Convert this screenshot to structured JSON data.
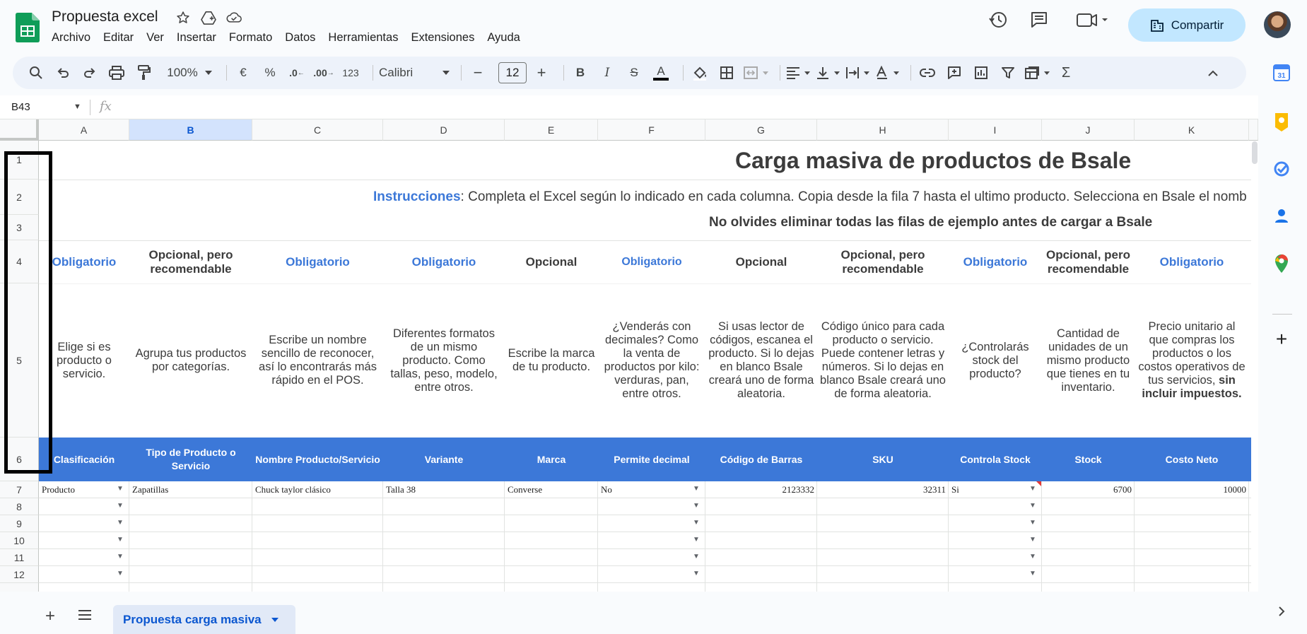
{
  "header": {
    "doc_title": "Propuesta excel",
    "menu": [
      "Archivo",
      "Editar",
      "Ver",
      "Insertar",
      "Formato",
      "Datos",
      "Herramientas",
      "Extensiones",
      "Ayuda"
    ],
    "share_label": "Compartir"
  },
  "toolbar": {
    "zoom": "100%",
    "currency": "€",
    "percent": "%",
    "dec_decrease": ".0",
    "dec_increase": ".00",
    "number_format": "123",
    "font": "Calibri",
    "font_size": "12",
    "bold": "B",
    "italic": "I",
    "strike": "S",
    "text_color": "A",
    "sum": "Σ"
  },
  "formula_bar": {
    "cell_ref": "B43",
    "fx": "fx",
    "value": ""
  },
  "columns": [
    "A",
    "B",
    "C",
    "D",
    "E",
    "F",
    "G",
    "H",
    "I",
    "J",
    "K"
  ],
  "selected_column": "B",
  "rows": [
    "1",
    "2",
    "3",
    "4",
    "5",
    "6",
    "7",
    "8",
    "9",
    "10",
    "11",
    "12"
  ],
  "sheet": {
    "title": "Carga masiva de productos de Bsale",
    "instr_label": "Instrucciones",
    "instr_text": ": Completa el Excel según lo indicado en cada columna. Copia desde la fila 7 hasta el ultimo producto. Selecciona en Bsale el nomb",
    "warning": "No olvides eliminar todas las filas de ejemplo antes de cargar a Bsale",
    "requirement": [
      "Obligatorio",
      "Opcional, pero recomendable",
      "Obligatorio",
      "Obligatorio",
      "Opcional",
      "Obligatorio",
      "Opcional",
      "Opcional, pero recomendable",
      "Obligatorio",
      "Opcional, pero recomendable",
      "Obligatorio"
    ],
    "description": [
      "Elige si es producto o servicio.",
      "Agrupa tus productos por categorías.",
      "Escribe un nombre sencillo de reconocer, así lo encontrarás más rápido en el POS.",
      "Diferentes formatos de un mismo producto. Como tallas, peso, modelo, entre otros.",
      "Escribe la marca de tu producto.",
      "¿Venderás con decimales? Como la venta de productos por kilo: verduras, pan, entre otros.",
      "Si usas lector de códigos, escanea el producto. Si lo dejas en blanco Bsale creará uno de forma aleatoria.",
      "Código único para cada producto o servicio. Puede contener letras y números. Si lo dejas en blanco Bsale creará uno de forma aleatoria.",
      "¿Controlarás stock del producto?",
      "Cantidad de unidades de un mismo producto que tienes en tu inventario.",
      "Precio unitario al que compras los productos o los costos operativos de tus servicios, "
    ],
    "description_k_bold": "sin incluir impuestos.",
    "headers": [
      "Clasificación",
      "Tipo de Producto o Servicio",
      "Nombre Producto/Servicio",
      "Variante",
      "Marca",
      "Permite decimal",
      "Código de Barras",
      "SKU",
      "Controla Stock",
      "Stock",
      "Costo Neto"
    ],
    "example_row": [
      "Producto",
      "Zapatillas",
      "Chuck taylor clásico",
      "Talla 38",
      "Converse",
      "No",
      "2123332",
      "32311",
      "Si",
      "6700",
      "10000"
    ]
  },
  "colors": {
    "header_blue": "#3c78d8",
    "share_bg": "#c2e7ff",
    "sheets_green": "#0f9d58"
  },
  "tabs": {
    "active_sheet": "Propuesta carga masiva"
  },
  "icons": [
    "sheets-logo-icon",
    "star-icon",
    "move-to-drive-icon",
    "cloud-saved-icon",
    "history-icon",
    "comment-icon",
    "meet-icon",
    "calendar-icon",
    "keep-icon",
    "tasks-icon",
    "contacts-icon",
    "maps-icon",
    "plus-icon"
  ]
}
